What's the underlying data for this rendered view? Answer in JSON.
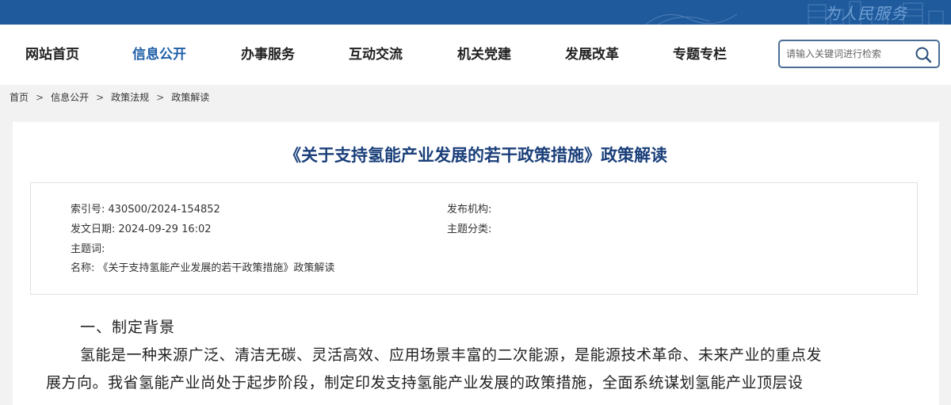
{
  "header": {
    "emblem_text": "为人民服务",
    "colors": {
      "topbar": "#1e5a9c",
      "accent": "#1f5fa8",
      "title": "#1a3f7a"
    }
  },
  "nav": {
    "items": [
      {
        "label": "网站首页",
        "active": false
      },
      {
        "label": "信息公开",
        "active": true
      },
      {
        "label": "办事服务",
        "active": false
      },
      {
        "label": "互动交流",
        "active": false
      },
      {
        "label": "机关党建",
        "active": false
      },
      {
        "label": "发展改革",
        "active": false
      },
      {
        "label": "专题专栏",
        "active": false
      }
    ]
  },
  "search": {
    "placeholder": "请输入关键词进行检索",
    "icon": "search-icon"
  },
  "breadcrumb": {
    "items": [
      "首页",
      "信息公开",
      "政策法规",
      "政策解读"
    ],
    "separator": ">"
  },
  "article": {
    "title": "《关于支持氢能产业发展的若干政策措施》政策解读",
    "meta": {
      "index_label": "索引号:",
      "index_value": "430S00/2024-154852",
      "publisher_label": "发布机构:",
      "publisher_value": "",
      "date_label": "发文日期:",
      "date_value": "2024-09-29 16:02",
      "category_label": "主题分类:",
      "category_value": "",
      "keywords_label": "主题词:",
      "keywords_value": "",
      "name_label": "名称:",
      "name_value": "《关于支持氢能产业发展的若干政策措施》政策解读"
    },
    "section_heading": "一、制定背景",
    "paragraph_lines": [
      "氢能是一种来源广泛、清洁无碳、灵活高效、应用场景丰富的二次能源，是能源技术革命、未来产业的重点发",
      "展方向。我省氢能产业尚处于起步阶段，制定印发支持氢能产业发展的政策措施，全面系统谋划氢能产业顶层设"
    ]
  }
}
